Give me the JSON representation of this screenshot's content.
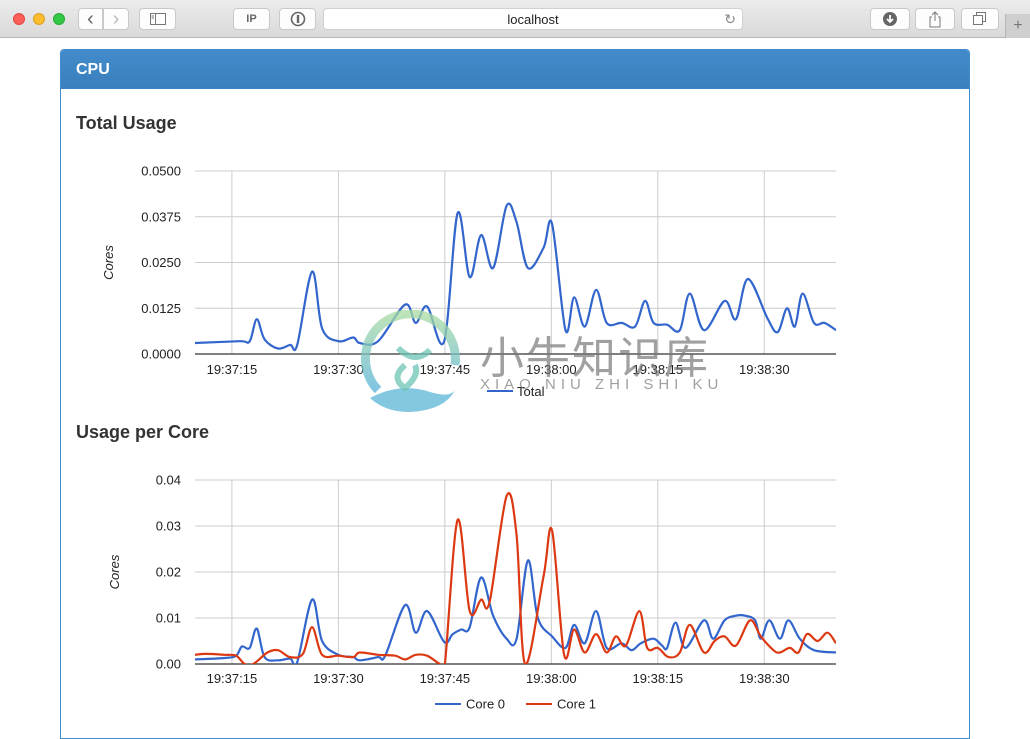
{
  "browser": {
    "url": "localhost",
    "buttons": {
      "back": "‹",
      "forward": "›",
      "ip_label": "IP",
      "reload": "↻",
      "new_tab": "+"
    }
  },
  "panel": {
    "title": "CPU"
  },
  "sections": {
    "total_title": "Total Usage",
    "per_core_title": "Usage per Core"
  },
  "watermark": {
    "cn": "小牛知识库",
    "en": "XIAO NIU ZHI SHI KU"
  },
  "chart_data": [
    {
      "type": "line",
      "title": "Total Usage",
      "xlabel": "",
      "ylabel": "Cores",
      "xlim": [
        "19:37:09.8",
        "19:38:40"
      ],
      "ylim": [
        0,
        0.05
      ],
      "yticks": [
        "0.0000",
        "0.0125",
        "0.0250",
        "0.0375",
        "0.0500"
      ],
      "ytick_values": [
        0,
        0.0125,
        0.025,
        0.0375,
        0.05
      ],
      "xticks": [
        "19:37:15",
        "19:37:30",
        "19:37:45",
        "19:38:00",
        "19:38:15",
        "19:38:30"
      ],
      "xtick_seconds": [
        15,
        30,
        45,
        60,
        75,
        90
      ],
      "grid": true,
      "legend": "bottom",
      "x_unit": "seconds after 19:37:00",
      "series": [
        {
          "name": "Total",
          "color": "#3366cc",
          "points": [
            [
              9.8,
              0.003
            ],
            [
              16.1,
              0.0035
            ],
            [
              17.5,
              0.0035
            ],
            [
              18.5,
              0.0095
            ],
            [
              19.6,
              0.004
            ],
            [
              21.5,
              0.0015
            ],
            [
              23.2,
              0.0025
            ],
            [
              24.2,
              0.0025
            ],
            [
              26.3,
              0.0225
            ],
            [
              27.7,
              0.007
            ],
            [
              30,
              0.0035
            ],
            [
              32.1,
              0.0045
            ],
            [
              33.0,
              0.003
            ],
            [
              35.6,
              0.0035
            ],
            [
              39.4,
              0.0135
            ],
            [
              40.9,
              0.0085
            ],
            [
              42.5,
              0.013
            ],
            [
              44.9,
              0.0035
            ],
            [
              46.8,
              0.0385
            ],
            [
              48.5,
              0.021
            ],
            [
              50.1,
              0.0325
            ],
            [
              51.8,
              0.0235
            ],
            [
              53.7,
              0.0405
            ],
            [
              55.1,
              0.036
            ],
            [
              56.7,
              0.0235
            ],
            [
              58.9,
              0.029
            ],
            [
              60.1,
              0.0355
            ],
            [
              62.0,
              0.0065
            ],
            [
              63.2,
              0.0155
            ],
            [
              64.7,
              0.0075
            ],
            [
              66.3,
              0.0175
            ],
            [
              67.8,
              0.0085
            ],
            [
              69.9,
              0.0085
            ],
            [
              71.8,
              0.0075
            ],
            [
              73.2,
              0.0145
            ],
            [
              74.4,
              0.0085
            ],
            [
              76.3,
              0.008
            ],
            [
              78.1,
              0.0065
            ],
            [
              79.5,
              0.0165
            ],
            [
              81.5,
              0.0065
            ],
            [
              84.4,
              0.0145
            ],
            [
              86.0,
              0.0095
            ],
            [
              87.7,
              0.0205
            ],
            [
              90.5,
              0.0095
            ],
            [
              91.9,
              0.006
            ],
            [
              93.2,
              0.0125
            ],
            [
              94.3,
              0.0075
            ],
            [
              95.4,
              0.0165
            ],
            [
              97.0,
              0.0085
            ],
            [
              98.5,
              0.0085
            ],
            [
              100.1,
              0.0065
            ]
          ]
        }
      ]
    },
    {
      "type": "line",
      "title": "Usage per Core",
      "xlabel": "",
      "ylabel": "Cores",
      "xlim": [
        "19:37:09.8",
        "19:38:40"
      ],
      "ylim": [
        0,
        0.04
      ],
      "yticks": [
        "0.00",
        "0.01",
        "0.02",
        "0.03",
        "0.04"
      ],
      "ytick_values": [
        0,
        0.01,
        0.02,
        0.03,
        0.04
      ],
      "xticks": [
        "19:37:15",
        "19:37:30",
        "19:37:45",
        "19:38:00",
        "19:38:15",
        "19:38:30"
      ],
      "xtick_seconds": [
        15,
        30,
        45,
        60,
        75,
        90
      ],
      "grid": true,
      "legend": "bottom",
      "x_unit": "seconds after 19:37:00",
      "series": [
        {
          "name": "Core 0",
          "color": "#3366cc",
          "points": [
            [
              9.8,
              0.001
            ],
            [
              14.0,
              0.0013
            ],
            [
              15.6,
              0.0018
            ],
            [
              16.4,
              0.0038
            ],
            [
              17.5,
              0.0035
            ],
            [
              18.5,
              0.0077
            ],
            [
              19.6,
              0.0015
            ],
            [
              21.5,
              0.0008
            ],
            [
              23.2,
              0.0012
            ],
            [
              24.2,
              0.0004
            ],
            [
              26.3,
              0.014
            ],
            [
              27.7,
              0.005
            ],
            [
              30.0,
              0.002
            ],
            [
              32.1,
              0.0015
            ],
            [
              33.0,
              0.0008
            ],
            [
              35.6,
              0.0015
            ],
            [
              36.6,
              0.0018
            ],
            [
              39.4,
              0.0128
            ],
            [
              40.9,
              0.0068
            ],
            [
              42.5,
              0.0115
            ],
            [
              44.9,
              0.0048
            ],
            [
              46.1,
              0.0065
            ],
            [
              47.3,
              0.0075
            ],
            [
              48.5,
              0.008
            ],
            [
              50.1,
              0.0188
            ],
            [
              51.8,
              0.0105
            ],
            [
              53.7,
              0.0055
            ],
            [
              55.1,
              0.0055
            ],
            [
              56.7,
              0.0225
            ],
            [
              58.1,
              0.01
            ],
            [
              60.1,
              0.006
            ],
            [
              62.0,
              0.0035
            ],
            [
              63.2,
              0.0085
            ],
            [
              64.7,
              0.0045
            ],
            [
              66.3,
              0.0115
            ],
            [
              67.8,
              0.0035
            ],
            [
              69.9,
              0.0045
            ],
            [
              71.3,
              0.003
            ],
            [
              72.6,
              0.0045
            ],
            [
              74.4,
              0.0055
            ],
            [
              75.6,
              0.004
            ],
            [
              76.3,
              0.0035
            ],
            [
              77.5,
              0.009
            ],
            [
              78.9,
              0.0035
            ],
            [
              81.5,
              0.0095
            ],
            [
              82.8,
              0.0055
            ],
            [
              84.4,
              0.0095
            ],
            [
              86.0,
              0.0105
            ],
            [
              87.3,
              0.0105
            ],
            [
              88.7,
              0.0095
            ],
            [
              89.5,
              0.0055
            ],
            [
              90.7,
              0.0095
            ],
            [
              92.2,
              0.0055
            ],
            [
              93.4,
              0.0095
            ],
            [
              95.0,
              0.0055
            ],
            [
              97.0,
              0.003
            ],
            [
              100.1,
              0.0025
            ]
          ]
        },
        {
          "name": "Core 1",
          "color": "#dc3912",
          "points": [
            [
              9.8,
              0.002
            ],
            [
              11.4,
              0.0022
            ],
            [
              14.0,
              0.002
            ],
            [
              15.6,
              0.0018
            ],
            [
              16.8,
              0.0
            ],
            [
              18.0,
              0.0
            ],
            [
              20.0,
              0.0025
            ],
            [
              21.5,
              0.003
            ],
            [
              23.2,
              0.0015
            ],
            [
              25.0,
              0.0022
            ],
            [
              26.3,
              0.008
            ],
            [
              27.7,
              0.002
            ],
            [
              30.0,
              0.0018
            ],
            [
              32.1,
              0.0015
            ],
            [
              33.0,
              0.0025
            ],
            [
              35.6,
              0.002
            ],
            [
              38.0,
              0.0018
            ],
            [
              39.4,
              0.001
            ],
            [
              40.9,
              0.002
            ],
            [
              42.5,
              0.0018
            ],
            [
              44.3,
              0.0
            ],
            [
              45.0,
              0.0
            ],
            [
              46.8,
              0.0313
            ],
            [
              48.5,
              0.0115
            ],
            [
              50.1,
              0.014
            ],
            [
              51.3,
              0.0135
            ],
            [
              53.7,
              0.0365
            ],
            [
              55.1,
              0.028
            ],
            [
              56.3,
              0.0
            ],
            [
              58.9,
              0.019
            ],
            [
              60.1,
              0.029
            ],
            [
              61.8,
              0.002
            ],
            [
              63.2,
              0.0075
            ],
            [
              64.7,
              0.0025
            ],
            [
              66.3,
              0.0065
            ],
            [
              67.8,
              0.0025
            ],
            [
              69.1,
              0.006
            ],
            [
              70.5,
              0.004
            ],
            [
              72.4,
              0.0115
            ],
            [
              73.5,
              0.0035
            ],
            [
              75.0,
              0.0035
            ],
            [
              76.5,
              0.0015
            ],
            [
              78.1,
              0.0025
            ],
            [
              79.5,
              0.0085
            ],
            [
              81.5,
              0.0025
            ],
            [
              83.0,
              0.005
            ],
            [
              84.4,
              0.006
            ],
            [
              86.0,
              0.004
            ],
            [
              88.0,
              0.0095
            ],
            [
              89.5,
              0.006
            ],
            [
              91.3,
              0.003
            ],
            [
              92.2,
              0.0025
            ],
            [
              93.6,
              0.0035
            ],
            [
              94.8,
              0.0025
            ],
            [
              96.0,
              0.0065
            ],
            [
              97.5,
              0.005
            ],
            [
              98.9,
              0.0068
            ],
            [
              100.1,
              0.0045
            ]
          ]
        }
      ]
    }
  ]
}
